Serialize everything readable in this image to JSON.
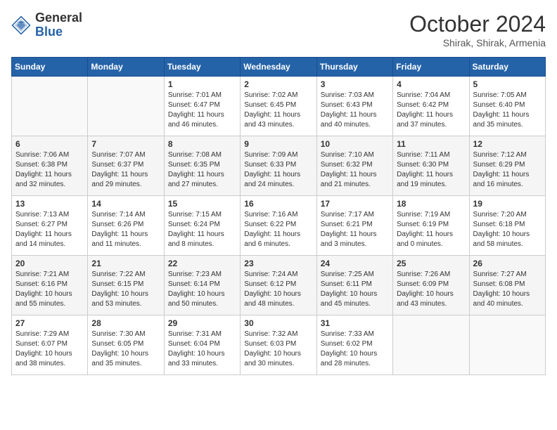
{
  "header": {
    "logo_general": "General",
    "logo_blue": "Blue",
    "month_title": "October 2024",
    "location": "Shirak, Shirak, Armenia"
  },
  "days_of_week": [
    "Sunday",
    "Monday",
    "Tuesday",
    "Wednesday",
    "Thursday",
    "Friday",
    "Saturday"
  ],
  "weeks": [
    [
      {
        "day": "",
        "info": ""
      },
      {
        "day": "",
        "info": ""
      },
      {
        "day": "1",
        "info": "Sunrise: 7:01 AM\nSunset: 6:47 PM\nDaylight: 11 hours and 46 minutes."
      },
      {
        "day": "2",
        "info": "Sunrise: 7:02 AM\nSunset: 6:45 PM\nDaylight: 11 hours and 43 minutes."
      },
      {
        "day": "3",
        "info": "Sunrise: 7:03 AM\nSunset: 6:43 PM\nDaylight: 11 hours and 40 minutes."
      },
      {
        "day": "4",
        "info": "Sunrise: 7:04 AM\nSunset: 6:42 PM\nDaylight: 11 hours and 37 minutes."
      },
      {
        "day": "5",
        "info": "Sunrise: 7:05 AM\nSunset: 6:40 PM\nDaylight: 11 hours and 35 minutes."
      }
    ],
    [
      {
        "day": "6",
        "info": "Sunrise: 7:06 AM\nSunset: 6:38 PM\nDaylight: 11 hours and 32 minutes."
      },
      {
        "day": "7",
        "info": "Sunrise: 7:07 AM\nSunset: 6:37 PM\nDaylight: 11 hours and 29 minutes."
      },
      {
        "day": "8",
        "info": "Sunrise: 7:08 AM\nSunset: 6:35 PM\nDaylight: 11 hours and 27 minutes."
      },
      {
        "day": "9",
        "info": "Sunrise: 7:09 AM\nSunset: 6:33 PM\nDaylight: 11 hours and 24 minutes."
      },
      {
        "day": "10",
        "info": "Sunrise: 7:10 AM\nSunset: 6:32 PM\nDaylight: 11 hours and 21 minutes."
      },
      {
        "day": "11",
        "info": "Sunrise: 7:11 AM\nSunset: 6:30 PM\nDaylight: 11 hours and 19 minutes."
      },
      {
        "day": "12",
        "info": "Sunrise: 7:12 AM\nSunset: 6:29 PM\nDaylight: 11 hours and 16 minutes."
      }
    ],
    [
      {
        "day": "13",
        "info": "Sunrise: 7:13 AM\nSunset: 6:27 PM\nDaylight: 11 hours and 14 minutes."
      },
      {
        "day": "14",
        "info": "Sunrise: 7:14 AM\nSunset: 6:26 PM\nDaylight: 11 hours and 11 minutes."
      },
      {
        "day": "15",
        "info": "Sunrise: 7:15 AM\nSunset: 6:24 PM\nDaylight: 11 hours and 8 minutes."
      },
      {
        "day": "16",
        "info": "Sunrise: 7:16 AM\nSunset: 6:22 PM\nDaylight: 11 hours and 6 minutes."
      },
      {
        "day": "17",
        "info": "Sunrise: 7:17 AM\nSunset: 6:21 PM\nDaylight: 11 hours and 3 minutes."
      },
      {
        "day": "18",
        "info": "Sunrise: 7:19 AM\nSunset: 6:19 PM\nDaylight: 11 hours and 0 minutes."
      },
      {
        "day": "19",
        "info": "Sunrise: 7:20 AM\nSunset: 6:18 PM\nDaylight: 10 hours and 58 minutes."
      }
    ],
    [
      {
        "day": "20",
        "info": "Sunrise: 7:21 AM\nSunset: 6:16 PM\nDaylight: 10 hours and 55 minutes."
      },
      {
        "day": "21",
        "info": "Sunrise: 7:22 AM\nSunset: 6:15 PM\nDaylight: 10 hours and 53 minutes."
      },
      {
        "day": "22",
        "info": "Sunrise: 7:23 AM\nSunset: 6:14 PM\nDaylight: 10 hours and 50 minutes."
      },
      {
        "day": "23",
        "info": "Sunrise: 7:24 AM\nSunset: 6:12 PM\nDaylight: 10 hours and 48 minutes."
      },
      {
        "day": "24",
        "info": "Sunrise: 7:25 AM\nSunset: 6:11 PM\nDaylight: 10 hours and 45 minutes."
      },
      {
        "day": "25",
        "info": "Sunrise: 7:26 AM\nSunset: 6:09 PM\nDaylight: 10 hours and 43 minutes."
      },
      {
        "day": "26",
        "info": "Sunrise: 7:27 AM\nSunset: 6:08 PM\nDaylight: 10 hours and 40 minutes."
      }
    ],
    [
      {
        "day": "27",
        "info": "Sunrise: 7:29 AM\nSunset: 6:07 PM\nDaylight: 10 hours and 38 minutes."
      },
      {
        "day": "28",
        "info": "Sunrise: 7:30 AM\nSunset: 6:05 PM\nDaylight: 10 hours and 35 minutes."
      },
      {
        "day": "29",
        "info": "Sunrise: 7:31 AM\nSunset: 6:04 PM\nDaylight: 10 hours and 33 minutes."
      },
      {
        "day": "30",
        "info": "Sunrise: 7:32 AM\nSunset: 6:03 PM\nDaylight: 10 hours and 30 minutes."
      },
      {
        "day": "31",
        "info": "Sunrise: 7:33 AM\nSunset: 6:02 PM\nDaylight: 10 hours and 28 minutes."
      },
      {
        "day": "",
        "info": ""
      },
      {
        "day": "",
        "info": ""
      }
    ]
  ]
}
